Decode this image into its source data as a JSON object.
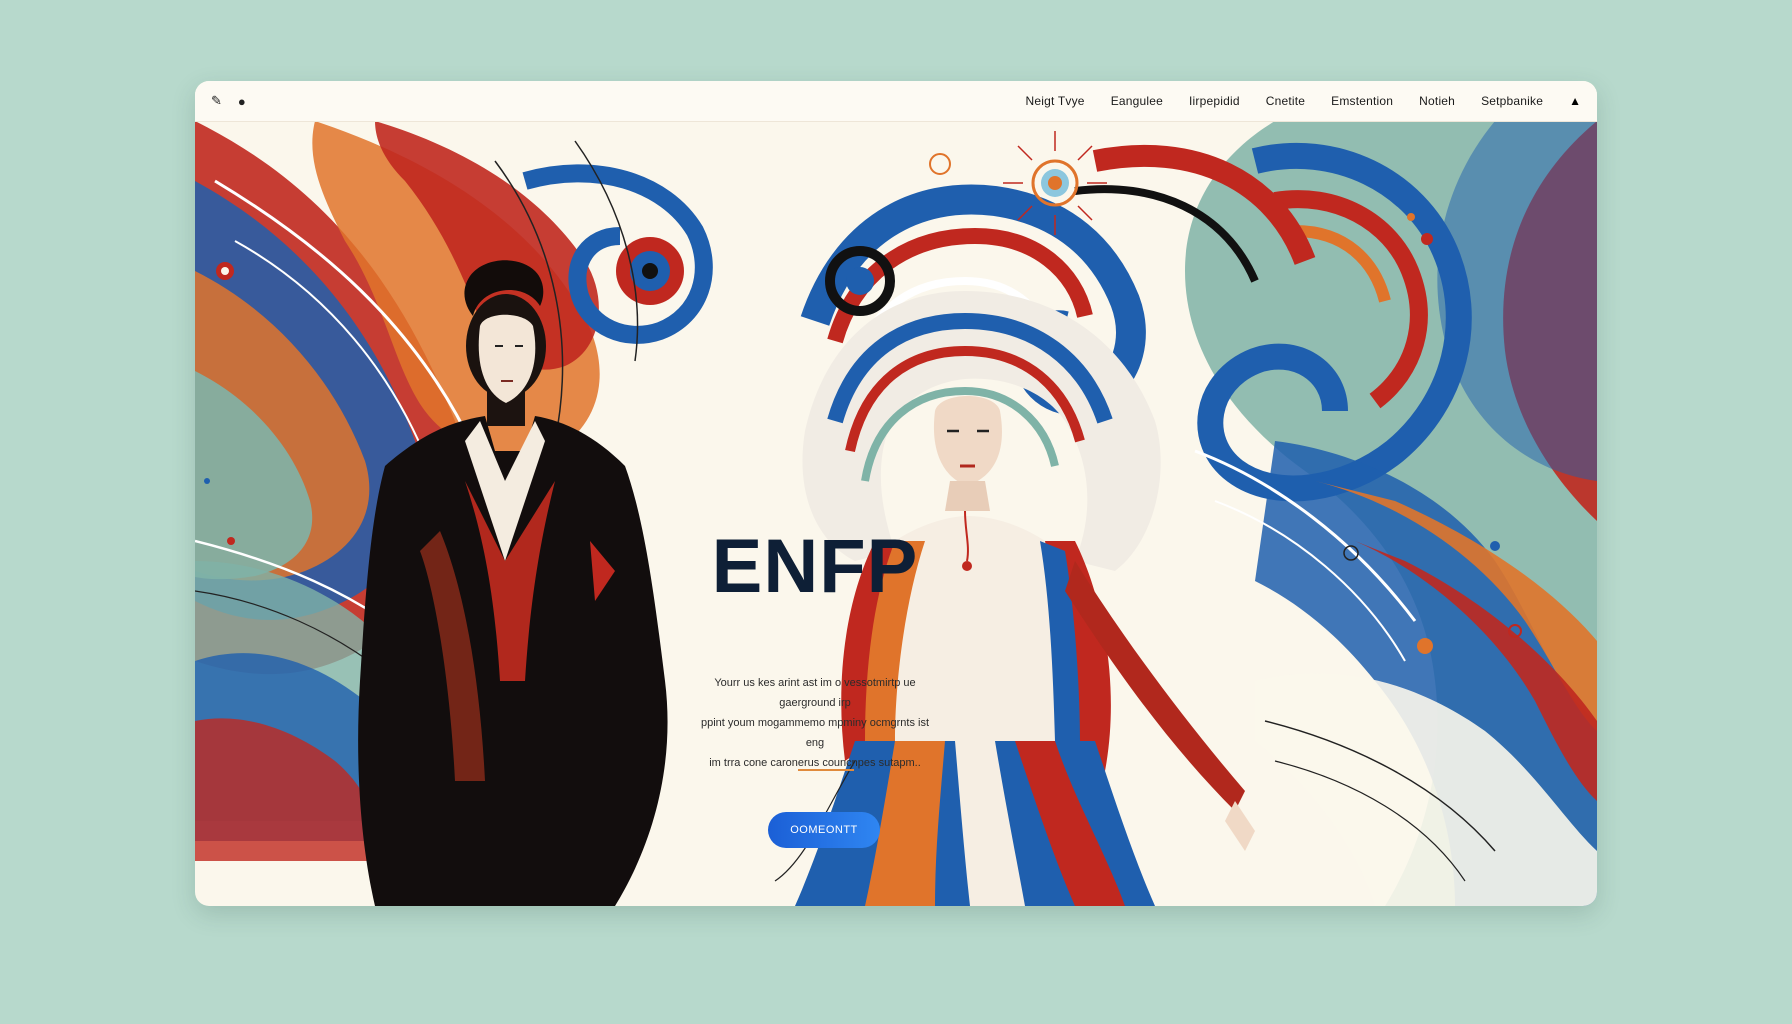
{
  "topbar": {
    "left_icons": [
      "pencil-icon",
      "dot-icon"
    ],
    "nav": [
      "Neigt Tvye",
      "Eangulee",
      "Iirpepidid",
      "Cnetite",
      "Emstention",
      "Notieh",
      "Setpbanike"
    ],
    "right_icon": "arrow-icon"
  },
  "hero": {
    "title": "ENFP",
    "body_lines": [
      "Yourr us kes arint ast im o vessotmirtp ue gaerground irp",
      "ppint youm mogammemo mpminy ocmgrnts ist eng",
      "im trra cone caronerus councnpes sutapm.."
    ],
    "cta": "OOMEONTT"
  },
  "colors": {
    "background": "#b7d9cc",
    "title": "#0e1f36",
    "accent_red": "#c0281f",
    "accent_orange": "#e0742b",
    "accent_blue": "#1f5fae",
    "accent_teal": "#7fb3a7",
    "cta": "#1f6fe0"
  }
}
